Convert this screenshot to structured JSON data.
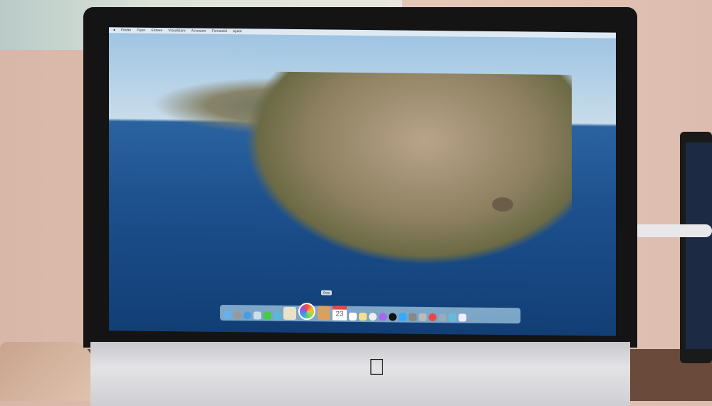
{
  "menubar": {
    "items": [
      "Finder",
      "Fișier",
      "Editare",
      "Vizualizare",
      "Accesare",
      "Fereastră",
      "Ajutor"
    ]
  },
  "dock": {
    "tooltip": "Poze",
    "calendar_day": "23",
    "items": [
      "finder",
      "launchpad",
      "safari",
      "mail",
      "messages",
      "maps",
      "photos",
      "contacts",
      "calendar",
      "reminders",
      "notes",
      "music",
      "podcasts",
      "tv",
      "app-store",
      "system-preferences",
      "preview",
      "news",
      "utilities",
      "downloads",
      "trash"
    ]
  },
  "apple_logo": ""
}
